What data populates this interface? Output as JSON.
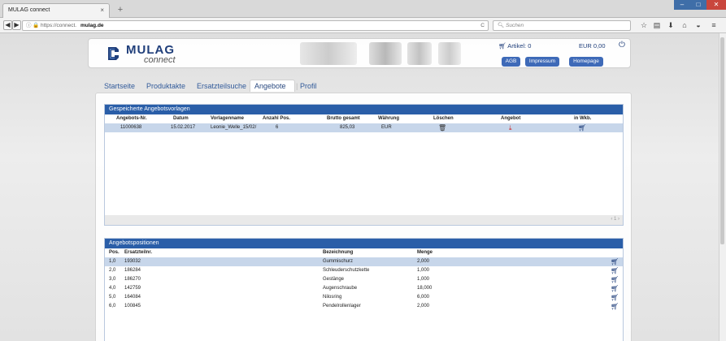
{
  "browser": {
    "tab_title": "MULAG connect",
    "tab_close": "×",
    "new_tab": "+",
    "url_prefix": "https://connect.",
    "url_domain": "mulag.de",
    "search_placeholder": "Suchen",
    "icons": [
      "back-icon",
      "forward-icon",
      "info-icon",
      "lock-icon",
      "reload-icon",
      "star-icon",
      "reading-list-icon",
      "download-icon",
      "home-icon",
      "pocket-icon",
      "menu-icon"
    ]
  },
  "header": {
    "logo_name": "MULAG",
    "logo_sub": "connect",
    "cart_label": "Artikel: 0",
    "cart_total": "EUR 0,00",
    "buttons": [
      "AGB",
      "Impressum",
      "Homepage"
    ]
  },
  "menu": {
    "items": [
      "Startseite",
      "Produktakte",
      "Ersatzteilsuche",
      "Angebote",
      "Profil"
    ],
    "active": "Angebote"
  },
  "templates": {
    "title": "Gespeicherte Angebotsvorlagen",
    "columns": [
      "Angebots-Nr.",
      "Datum",
      "Vorlagenname",
      "Anzahl Pos.",
      "Brutto gesamt",
      "Währung",
      "Löschen",
      "Angebot",
      "in Wkb."
    ],
    "rows": [
      {
        "nr": "11000638",
        "datum": "15.02.2017",
        "name": "Leonie_Welle_15/02/",
        "anzahl": "6",
        "brutto": "825,03",
        "waehrung": "EUR"
      }
    ],
    "pager": "‹ 1 ›"
  },
  "positions": {
    "title": "Angebotspositionen",
    "columns": [
      "Pos.",
      "Ersatzteilnr.",
      "Bezeichnung",
      "Menge"
    ],
    "rows": [
      {
        "pos": "1,0",
        "nr": "193032",
        "bez": "Gummischurz",
        "menge": "2,000"
      },
      {
        "pos": "2,0",
        "nr": "186284",
        "bez": "Schleuderschutzkette",
        "menge": "1,000"
      },
      {
        "pos": "3,0",
        "nr": "186270",
        "bez": "Gestänge",
        "menge": "1,000"
      },
      {
        "pos": "4,0",
        "nr": "142759",
        "bez": "Augenschraube",
        "menge": "18,000"
      },
      {
        "pos": "5,0",
        "nr": "164084",
        "bez": "Nilosring",
        "menge": "6,000"
      },
      {
        "pos": "6,0",
        "nr": "100845",
        "bez": "Pendelrollenlager",
        "menge": "2,000"
      }
    ]
  },
  "colors": {
    "brand": "#1f3e7a",
    "accent": "#2a5ea8",
    "selected_row": "#c7d6ea",
    "pdf": "#cc2222"
  }
}
